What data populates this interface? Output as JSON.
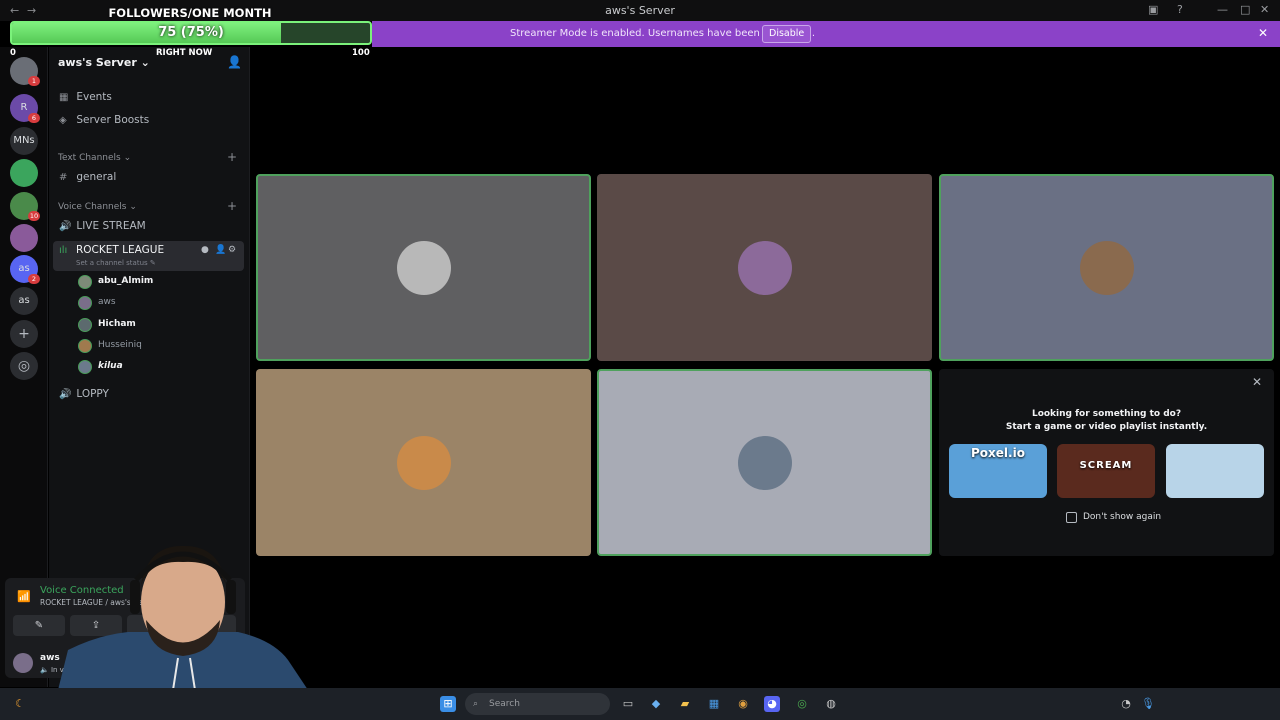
{
  "window": {
    "title": "aws's Server",
    "nav_back": "←",
    "nav_forward": "→"
  },
  "goal_overlay": {
    "title": "FOLLOWERS/ONE MONTH",
    "value_text": "75 (75%)",
    "progress": 0.75,
    "left_label": "0",
    "mid_label": "RIGHT NOW",
    "right_label": "100"
  },
  "banner": {
    "text": "Streamer Mode is enabled. Usernames have been truncated.",
    "button": "Disable",
    "close": "✕"
  },
  "rail": {
    "servers": [
      {
        "label": "",
        "badge": "1"
      },
      {
        "label": "R",
        "badge": "6"
      },
      {
        "label": "MNs",
        "badge": ""
      },
      {
        "label": "",
        "badge": ""
      },
      {
        "label": "",
        "badge": "10"
      },
      {
        "label": "",
        "badge": ""
      },
      {
        "label": "as",
        "badge": "2"
      },
      {
        "label": "as",
        "badge": ""
      }
    ],
    "add_icon": "+",
    "explore_icon": "◎"
  },
  "sidebar": {
    "server_name": "aws's Server",
    "top_items": [
      {
        "icon": "▦",
        "label": "Events"
      },
      {
        "icon": "◈",
        "label": "Server Boosts"
      }
    ],
    "text_category": "Text Channels",
    "text_channels": [
      {
        "label": "general"
      }
    ],
    "voice_category": "Voice Channels",
    "live_stream": "LIVE STREAM",
    "active_voice": {
      "name": "ROCKET LEAGUE",
      "status": "Set a channel status"
    },
    "members": [
      {
        "name": "abu_Almim",
        "bold": true
      },
      {
        "name": "aws",
        "bold": false
      },
      {
        "name": "Hicham",
        "bold": true
      },
      {
        "name": "Husseiniq",
        "bold": false
      },
      {
        "name": "kilua",
        "bold": true
      }
    ],
    "loppy": "LOPPY"
  },
  "user_panel": {
    "voice_title": "Voice Connected",
    "voice_sub": "ROCKET LEAGUE / aws's Server",
    "username": "aws",
    "state": "In voice"
  },
  "grid": {
    "tiles": [
      {
        "bg": "#5f5f61",
        "speaking": true,
        "avatar": "#b8b8b8"
      },
      {
        "bg": "#5a4a47",
        "speaking": false,
        "avatar": "#8c6a9a"
      },
      {
        "bg": "#6a7084",
        "speaking": true,
        "avatar": "#8a6a4e"
      },
      {
        "bg": "#9b8467",
        "speaking": false,
        "avatar": "#c98a4a"
      },
      {
        "bg": "#a8abb5",
        "speaking": true,
        "avatar": "#6b7a8c"
      }
    ]
  },
  "activity": {
    "line1": "Looking for something to do?",
    "line2": "Start a game or video playlist instantly.",
    "cards": [
      {
        "label": "Poxel.io",
        "color": "#5aa0d8"
      },
      {
        "label": "SCREAM",
        "color": "#5a2a1e"
      },
      {
        "label": "",
        "color": "#b8d4e8"
      }
    ],
    "dont_show": "Don't show again",
    "close": "✕"
  },
  "taskbar": {
    "search_placeholder": "Search"
  },
  "colors": {
    "banner": "#8b42c8",
    "speaking": "#4fa15d",
    "goal_fill": "#6fe26f"
  }
}
